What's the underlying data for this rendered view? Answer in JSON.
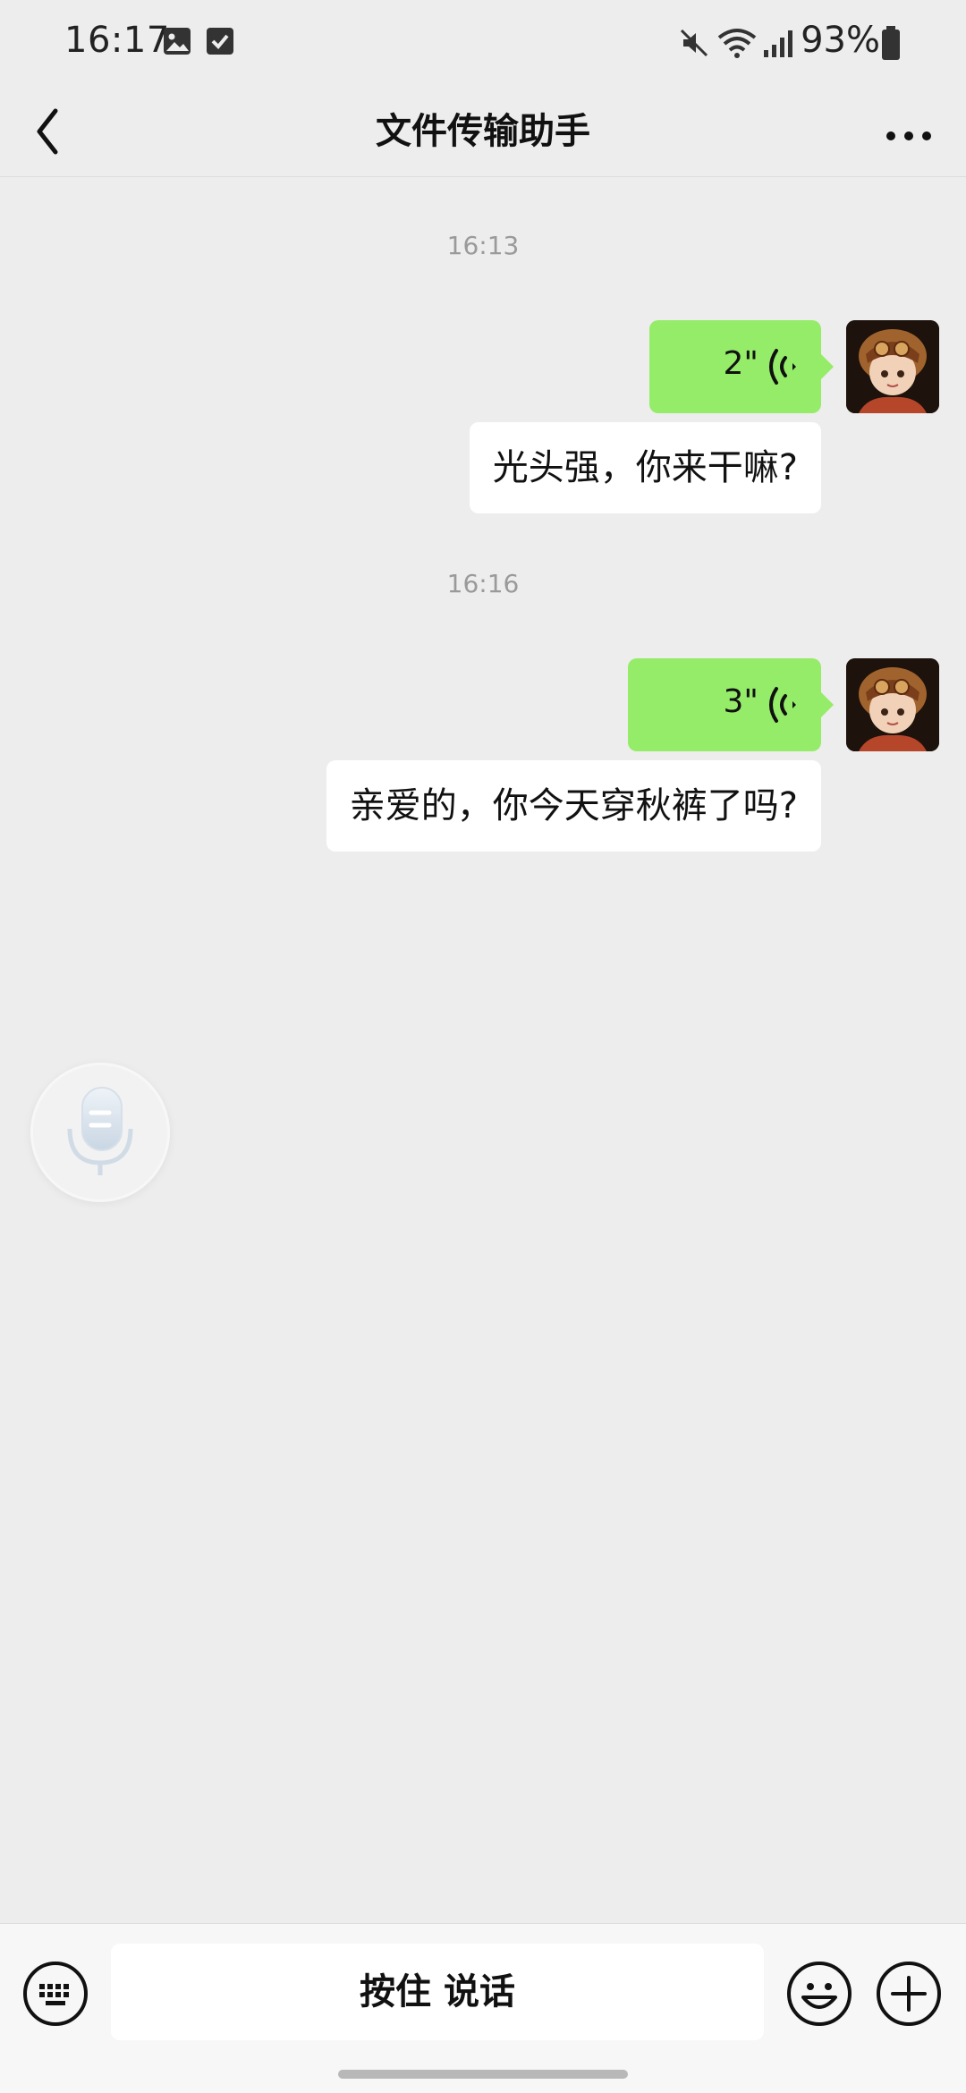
{
  "status_bar": {
    "time": "16:17",
    "battery": "93%",
    "icons": [
      "gallery-icon",
      "check-square-icon",
      "mute-icon",
      "wifi-icon",
      "signal-icon",
      "battery-icon"
    ]
  },
  "nav": {
    "title": "文件传输助手",
    "back_icon": "chevron-left-icon",
    "more_icon": "more-dots-icon"
  },
  "messages": [
    {
      "type": "timestamp",
      "text": "16:13"
    },
    {
      "type": "voice",
      "duration": "2\"",
      "sender": "me"
    },
    {
      "type": "text",
      "text": "光头强，你来干嘛?",
      "sender": "me"
    },
    {
      "type": "timestamp",
      "text": "16:16"
    },
    {
      "type": "voice",
      "duration": "3\"",
      "sender": "me"
    },
    {
      "type": "text",
      "text": "亲爱的，你今天穿秋裤了吗?",
      "sender": "me"
    }
  ],
  "input_bar": {
    "hold_to_talk": "按住 说话",
    "keyboard_icon": "keyboard-icon",
    "emoji_icon": "emoji-icon",
    "plus_icon": "plus-circle-icon"
  },
  "colors": {
    "background": "#ededed",
    "my_bubble": "#95ec69",
    "text_bubble": "#ffffff"
  }
}
